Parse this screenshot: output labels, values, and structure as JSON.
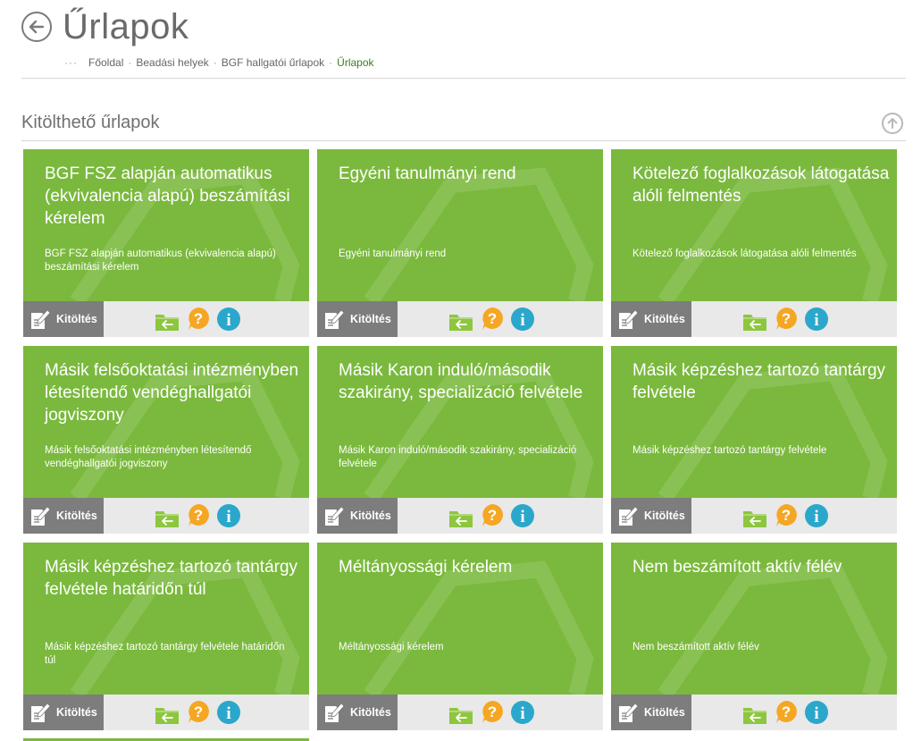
{
  "page": {
    "title": "Űrlapok",
    "breadcrumb": {
      "ellipsis": "···",
      "items": [
        "Főoldal",
        "Beadási helyek",
        "BGF hallgatói űrlapok"
      ],
      "current": "Űrlapok"
    }
  },
  "section": {
    "title": "Kitölthető űrlapok"
  },
  "colors": {
    "card_green": "#7ab93d",
    "footer_gray": "#e9e9e9",
    "fill_button": "#7d7d7d",
    "help_orange": "#f5a623",
    "info_blue": "#2ba7cc"
  },
  "icons": {
    "back": "arrow-left-circle-icon",
    "up": "arrow-up-circle-icon",
    "fill": "form-edit-icon",
    "folder": "folder-arrow-icon",
    "help": "question-icon",
    "info": "info-icon"
  },
  "cards": [
    {
      "title": "BGF FSZ alapján automatikus (ekvivalencia alapú) beszámítási kérelem",
      "description": "BGF FSZ alapján automatikus (ekvivalencia alapú) beszámítási kérelem",
      "fill_label": "Kitöltés"
    },
    {
      "title": "Egyéni tanulmányi rend",
      "description": "Egyéni tanulmányi rend",
      "fill_label": "Kitöltés"
    },
    {
      "title": "Kötelező foglalkozások látogatása alóli felmentés",
      "description": "Kötelező foglalkozások látogatása alóli felmentés",
      "fill_label": "Kitöltés"
    },
    {
      "title": "Másik felsőoktatási intézményben létesítendő vendéghallgatói jogviszony",
      "description": "Másik felsőoktatási intézményben létesítendő vendéghallgatói jogviszony",
      "fill_label": "Kitöltés"
    },
    {
      "title": "Másik Karon induló/második szakirány, specializáció felvétele",
      "description": "Másik Karon induló/második szakirány, specializáció felvétele",
      "fill_label": "Kitöltés"
    },
    {
      "title": "Másik képzéshez tartozó tantárgy felvétele",
      "description": "Másik képzéshez tartozó tantárgy felvétele",
      "fill_label": "Kitöltés"
    },
    {
      "title": "Másik képzéshez tartozó tantárgy felvétele határidőn túl",
      "description": "Másik képzéshez tartozó tantárgy felvétele határidőn túl",
      "fill_label": "Kitöltés"
    },
    {
      "title": "Méltányossági kérelem",
      "description": "Méltányossági kérelem",
      "fill_label": "Kitöltés"
    },
    {
      "title": "Nem beszámított aktív félév",
      "description": "Nem beszámított aktív félév",
      "fill_label": "Kitöltés"
    }
  ]
}
